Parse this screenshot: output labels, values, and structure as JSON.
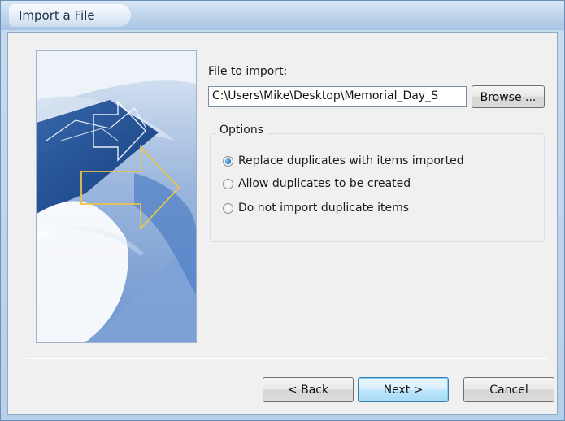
{
  "window": {
    "title": "Import a File"
  },
  "file_section": {
    "label": "File to import:",
    "path_value": "C:\\Users\\Mike\\Desktop\\Memorial_Day_S",
    "browse_label": "Browse ..."
  },
  "options": {
    "legend": "Options",
    "items": [
      {
        "label": "Replace duplicates with items imported",
        "checked": true
      },
      {
        "label": "Allow duplicates to be created",
        "checked": false
      },
      {
        "label": "Do not import duplicate items",
        "checked": false
      }
    ]
  },
  "footer": {
    "back_label": "< Back",
    "next_label": "Next >",
    "cancel_label": "Cancel"
  },
  "colors": {
    "title_bar": "#bcd3ea",
    "client_bg": "#f0f0f0",
    "default_button": "#bee6fd",
    "art_arrow": "#e8c24a"
  },
  "icons": {
    "art": "import-wizard-art"
  }
}
